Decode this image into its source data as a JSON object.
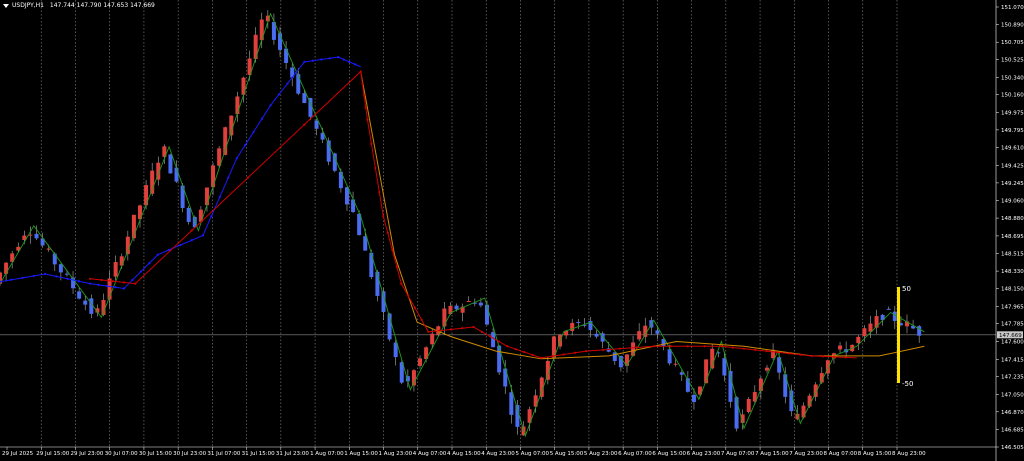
{
  "symbol": {
    "name": "USDJPY,H1",
    "ohlc": "147.744 147.790 147.653 147.669"
  },
  "current_price_tag": "147.669",
  "indicator_levels": {
    "upper": "50",
    "lower": "-50"
  },
  "colors": {
    "background": "#000000",
    "bull_candle": "#e0403c",
    "bear_candle": "#4a6cf0",
    "zigzag": "#1f9b1f",
    "ma_blue": "#1a1aff",
    "ma_red": "#d00000",
    "ma_orange": "#d08a00",
    "oscillator_bar": "#ffe100",
    "grid": "#8a8a8a",
    "price_line": "#8a8a8a"
  },
  "price_axis": {
    "min": 146.505,
    "max": 151.07,
    "ticks": [
      "151.070",
      "150.890",
      "150.705",
      "150.525",
      "150.340",
      "150.160",
      "149.975",
      "149.795",
      "149.610",
      "149.425",
      "149.245",
      "149.060",
      "148.880",
      "148.695",
      "148.515",
      "148.330",
      "148.150",
      "147.965",
      "147.785",
      "147.600",
      "147.415",
      "147.235",
      "147.050",
      "146.870",
      "146.685",
      "146.505"
    ]
  },
  "time_axis": {
    "labels": [
      "29 Jul 2025",
      "29 Jul 15:00",
      "29 Jul 23:00",
      "30 Jul 07:00",
      "30 Jul 15:00",
      "30 Jul 23:00",
      "31 Jul 07:00",
      "31 Jul 15:00",
      "31 Jul 23:00",
      "1 Aug 07:00",
      "1 Aug 15:00",
      "1 Aug 23:00",
      "4 Aug 07:00",
      "4 Aug 15:00",
      "4 Aug 23:00",
      "5 Aug 07:00",
      "5 Aug 15:00",
      "5 Aug 23:00",
      "6 Aug 07:00",
      "6 Aug 15:00",
      "6 Aug 23:00",
      "7 Aug 07:00",
      "7 Aug 15:00",
      "7 Aug 23:00",
      "8 Aug 07:00",
      "8 Aug 15:00",
      "8 Aug 23:00"
    ]
  },
  "chart_data": {
    "type": "candlestick",
    "symbol": "USDJPY",
    "timeframe": "H1",
    "last_price": 147.669,
    "ylim": [
      146.505,
      151.07
    ],
    "zigzag": [
      {
        "x": 0,
        "y": 148.2
      },
      {
        "x": 15,
        "y": 148.8
      },
      {
        "x": 45,
        "y": 147.85
      },
      {
        "x": 75,
        "y": 149.62
      },
      {
        "x": 88,
        "y": 148.75
      },
      {
        "x": 120,
        "y": 151.0
      },
      {
        "x": 160,
        "y": 148.9
      },
      {
        "x": 182,
        "y": 147.1
      },
      {
        "x": 200,
        "y": 147.9
      },
      {
        "x": 215,
        "y": 148.05
      },
      {
        "x": 233,
        "y": 146.62
      },
      {
        "x": 250,
        "y": 147.7
      },
      {
        "x": 262,
        "y": 147.8
      },
      {
        "x": 278,
        "y": 147.35
      },
      {
        "x": 290,
        "y": 147.82
      },
      {
        "x": 310,
        "y": 147.0
      },
      {
        "x": 320,
        "y": 147.6
      },
      {
        "x": 330,
        "y": 146.7
      },
      {
        "x": 345,
        "y": 147.5
      },
      {
        "x": 355,
        "y": 146.75
      },
      {
        "x": 370,
        "y": 147.45
      },
      {
        "x": 380,
        "y": 147.55
      },
      {
        "x": 395,
        "y": 147.9
      },
      {
        "x": 410,
        "y": 147.7
      }
    ],
    "ma_blue_points": [
      {
        "x": 0,
        "y": 148.22
      },
      {
        "x": 20,
        "y": 148.3
      },
      {
        "x": 40,
        "y": 148.2
      },
      {
        "x": 55,
        "y": 148.15
      },
      {
        "x": 70,
        "y": 148.5
      },
      {
        "x": 90,
        "y": 148.7
      },
      {
        "x": 105,
        "y": 149.5
      },
      {
        "x": 120,
        "y": 150.05
      },
      {
        "x": 135,
        "y": 150.5
      },
      {
        "x": 150,
        "y": 150.55
      },
      {
        "x": 160,
        "y": 150.45
      }
    ],
    "ma_red_points": [
      {
        "x": 40,
        "y": 148.25
      },
      {
        "x": 60,
        "y": 148.2
      },
      {
        "x": 160,
        "y": 150.4
      },
      {
        "x": 163,
        "y": 149.9
      },
      {
        "x": 170,
        "y": 148.9
      },
      {
        "x": 178,
        "y": 148.2
      },
      {
        "x": 190,
        "y": 147.7
      },
      {
        "x": 210,
        "y": 147.75
      },
      {
        "x": 225,
        "y": 147.55
      },
      {
        "x": 240,
        "y": 147.43
      },
      {
        "x": 260,
        "y": 147.5
      },
      {
        "x": 290,
        "y": 147.55
      },
      {
        "x": 320,
        "y": 147.55
      },
      {
        "x": 340,
        "y": 147.5
      },
      {
        "x": 360,
        "y": 147.45
      },
      {
        "x": 380,
        "y": 147.43
      }
    ],
    "ma_orange_points": [
      {
        "x": 160,
        "y": 150.4
      },
      {
        "x": 175,
        "y": 148.5
      },
      {
        "x": 185,
        "y": 147.8
      },
      {
        "x": 200,
        "y": 147.65
      },
      {
        "x": 220,
        "y": 147.5
      },
      {
        "x": 240,
        "y": 147.42
      },
      {
        "x": 270,
        "y": 147.45
      },
      {
        "x": 300,
        "y": 147.6
      },
      {
        "x": 330,
        "y": 147.55
      },
      {
        "x": 360,
        "y": 147.45
      },
      {
        "x": 390,
        "y": 147.45
      },
      {
        "x": 410,
        "y": 147.55
      }
    ],
    "oscillator": {
      "upper_label": "50",
      "lower_label": "-50"
    }
  }
}
